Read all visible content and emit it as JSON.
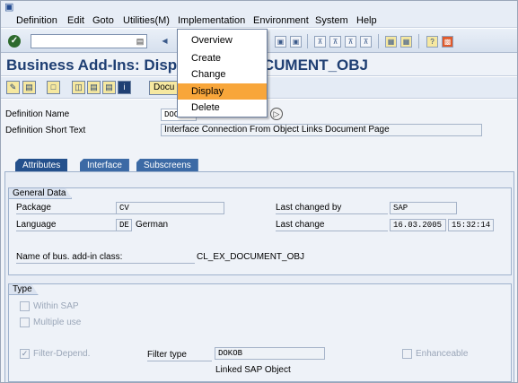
{
  "menubar": {
    "items": [
      "Definition",
      "Edit",
      "Goto",
      "Utilities(M)",
      "Implementation",
      "Environment",
      "System",
      "Help"
    ]
  },
  "implementation_menu": {
    "options": [
      "Overview",
      "Create",
      "Change",
      "Display",
      "Delete"
    ],
    "selected": "Display"
  },
  "title": {
    "left": "Business Add-Ins: Displa",
    "right": "DOCUMENT_OBJ"
  },
  "app_toolbar": {
    "docu_label": "Docu"
  },
  "definition": {
    "name_label": "Definition Name",
    "name_value": "DOC",
    "short_text_label": "Definition Short Text",
    "short_text_value": "Interface Connection From Object Links Document Page"
  },
  "tabs": [
    "Attributes",
    "Interface",
    "Subscreens"
  ],
  "active_tab": "Attributes",
  "general_data": {
    "title": "General Data",
    "package_label": "Package",
    "package_value": "CV",
    "language_label": "Language",
    "language_code": "DE",
    "language_name": "German",
    "last_changed_by_label": "Last changed by",
    "last_changed_by_value": "SAP",
    "last_change_label": "Last change",
    "last_change_date": "16.03.2005",
    "last_change_time": "15:32:14",
    "class_label": "Name of bus. add-in class:",
    "class_value": "CL_EX_DOCUMENT_OBJ"
  },
  "type_group": {
    "title": "Type",
    "within_sap": "Within SAP",
    "multiple_use": "Multiple use",
    "filter_depend": "Filter-Depend.",
    "filter_type_label": "Filter type",
    "filter_type_value": "DOKOB",
    "filter_type_desc": "Linked SAP Object",
    "enhanceable": "Enhanceable"
  },
  "colors": {
    "title_text": "#1f3f73",
    "tab_bg": "#3c6aa5",
    "menu_highlight": "#f8a63a"
  }
}
